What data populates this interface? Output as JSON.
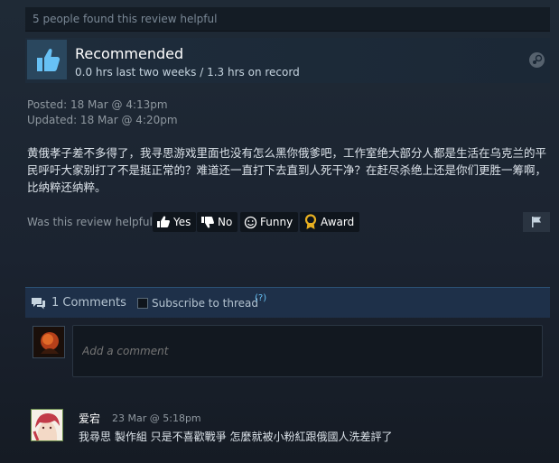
{
  "helpful_summary": "5 people found this review helpful",
  "recommendation": {
    "title": "Recommended",
    "hours": "0.0 hrs last two weeks / 1.3 hrs on record",
    "thumb_icon": "thumbs-up-icon",
    "platform_icon": "steam-icon"
  },
  "posted": "Posted: 18 Mar @ 4:13pm",
  "updated": "Updated: 18 Mar @ 4:20pm",
  "review_text": "黄俄孝子差不多得了，我寻思游戏里面也没有怎么黑你俄爹吧，工作室绝大部分人都是生活在乌克兰的平民呼吁大家别打了不是挺正常的？难道还一直打下去直到人死干净？在赶尽杀绝上还是你们更胜一筹啊，比纳粹还纳粹。",
  "helpful_question": "Was this review helpful?",
  "votes": {
    "yes": "Yes",
    "no": "No",
    "funny": "Funny",
    "award": "Award"
  },
  "comments": {
    "count_label": "1 Comments",
    "subscribe_label": "Subscribe to thread",
    "help_marker": "(?)",
    "input_placeholder": "Add a comment",
    "items": [
      {
        "author": "爱宕",
        "time": "23 Mar @ 5:18pm",
        "text": "我尋思 製作組 只是不喜歡戰爭 怎麼就被小粉紅跟俄國人洗差評了"
      }
    ]
  },
  "colors": {
    "accent_link": "#66c0f4",
    "award_gold": "#e8b021",
    "thumb_blue": "#67c1f5"
  }
}
